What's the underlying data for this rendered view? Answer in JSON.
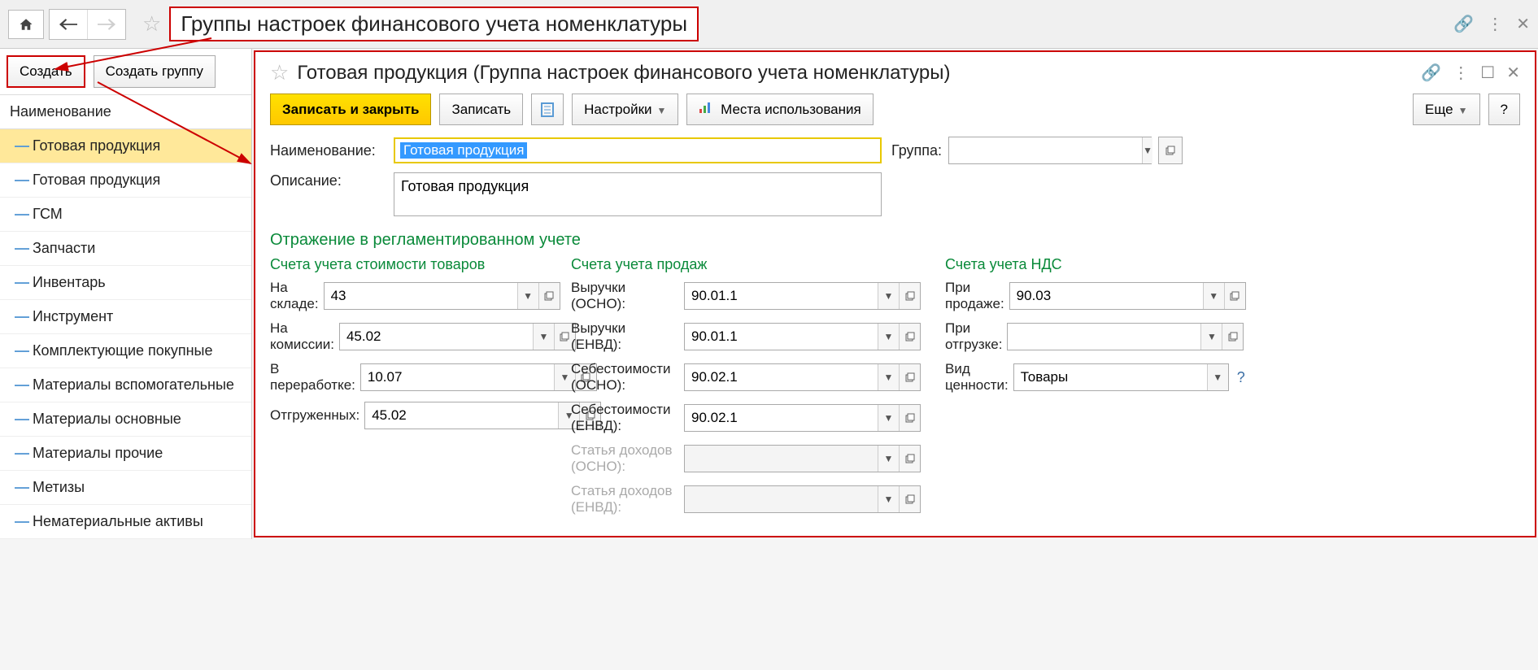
{
  "pageTitle": "Группы настроек финансового учета номенклатуры",
  "leftToolbar": {
    "create": "Создать",
    "createGroup": "Создать группу"
  },
  "listHeader": "Наименование",
  "listItems": [
    "Готовая продукция",
    "Готовая продукция",
    "ГСМ",
    "Запчасти",
    "Инвентарь",
    "Инструмент",
    "Комплектующие покупные",
    "Материалы вспомогательные",
    "Материалы основные",
    "Материалы прочие",
    "Метизы",
    "Нематериальные активы"
  ],
  "detail": {
    "title": "Готовая продукция (Группа настроек финансового учета номенклатуры)",
    "toolbar": {
      "saveClose": "Записать и закрыть",
      "save": "Записать",
      "settings": "Настройки",
      "usages": "Места использования",
      "more": "Еще",
      "help": "?"
    },
    "labels": {
      "name": "Наименование:",
      "description": "Описание:",
      "group": "Группа:"
    },
    "name": "Готовая продукция",
    "description": "Готовая продукция",
    "group": "",
    "section": "Отражение в регламентированном учете",
    "col1": {
      "title": "Счета учета стоимости товаров",
      "rows": {
        "warehouse": {
          "label": "На складе:",
          "value": "43"
        },
        "commission": {
          "label": "На комиссии:",
          "value": "45.02"
        },
        "processing": {
          "label": "В переработке:",
          "value": "10.07"
        },
        "shipped": {
          "label": "Отгруженных:",
          "value": "45.02"
        }
      }
    },
    "col2": {
      "title": "Счета учета продаж",
      "rows": {
        "revOsno": {
          "label": "Выручки (ОСНО):",
          "value": "90.01.1"
        },
        "revEnvd": {
          "label": "Выручки (ЕНВД):",
          "value": "90.01.1"
        },
        "costOsno": {
          "label": "Себестоимости (ОСНО):",
          "value": "90.02.1"
        },
        "costEnvd": {
          "label": "Себестоимости (ЕНВД):",
          "value": "90.02.1"
        },
        "incOsno": {
          "label": "Статья доходов (ОСНО):",
          "value": ""
        },
        "incEnvd": {
          "label": "Статья доходов (ЕНВД):",
          "value": ""
        }
      }
    },
    "col3": {
      "title": "Счета учета НДС",
      "rows": {
        "onSale": {
          "label": "При продаже:",
          "value": "90.03"
        },
        "onShip": {
          "label": "При отгрузке:",
          "value": ""
        },
        "valueType": {
          "label": "Вид ценности:",
          "value": "Товары"
        }
      }
    }
  }
}
